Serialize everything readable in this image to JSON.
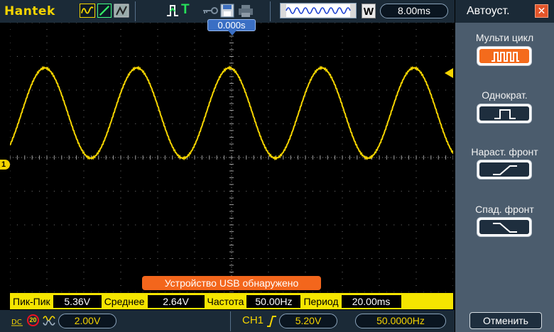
{
  "toolbar": {
    "brand": "Hantek",
    "trigger_status": "T",
    "timebase": "8.00ms",
    "window_badge": "W"
  },
  "plot": {
    "trigger_time": "0.000s",
    "channel_marker": "1",
    "usb_banner": "Устройство USB обнаружено",
    "trace_color": "#f5d400"
  },
  "chart_data": {
    "type": "line",
    "title": "",
    "series": [
      {
        "name": "",
        "waveform": "sine",
        "frequency_hz": 50.0,
        "peak_to_peak_v": 5.36,
        "mean_v": 2.64
      }
    ],
    "xlabel": "",
    "ylabel": ""
  },
  "measurements": [
    {
      "label": "Пик-Пик",
      "value": "5.36V"
    },
    {
      "label": "Среднее",
      "value": "2.64V"
    },
    {
      "label": "Частота",
      "value": "50.00Hz"
    },
    {
      "label": "Период",
      "value": "20.00ms"
    }
  ],
  "status": {
    "coupling": "DC",
    "bw_limit": "20",
    "volts_div": "2.00V",
    "trigger_source": "CH1",
    "trigger_level": "5.20V",
    "trigger_freq": "50.0000Hz"
  },
  "side_panel": {
    "title": "Автоуст.",
    "options": [
      {
        "label": "Мульти цикл",
        "icon": "multi-cycle-icon",
        "active": true
      },
      {
        "label": "Однократ.",
        "icon": "single-pulse-icon",
        "active": false
      },
      {
        "label": "Нараст. фронт",
        "icon": "rising-edge-icon",
        "active": false
      },
      {
        "label": "Спад. фронт",
        "icon": "falling-edge-icon",
        "active": false
      }
    ],
    "cancel_label": "Отменить"
  },
  "colors": {
    "accent_yellow": "#f5d400",
    "panel_bg": "#4b5c6d",
    "bar_bg": "#1b2a37",
    "active_orange": "#f46b1c",
    "banner_orange": "#f3661c",
    "trigger_blue": "#3a6fc4"
  }
}
